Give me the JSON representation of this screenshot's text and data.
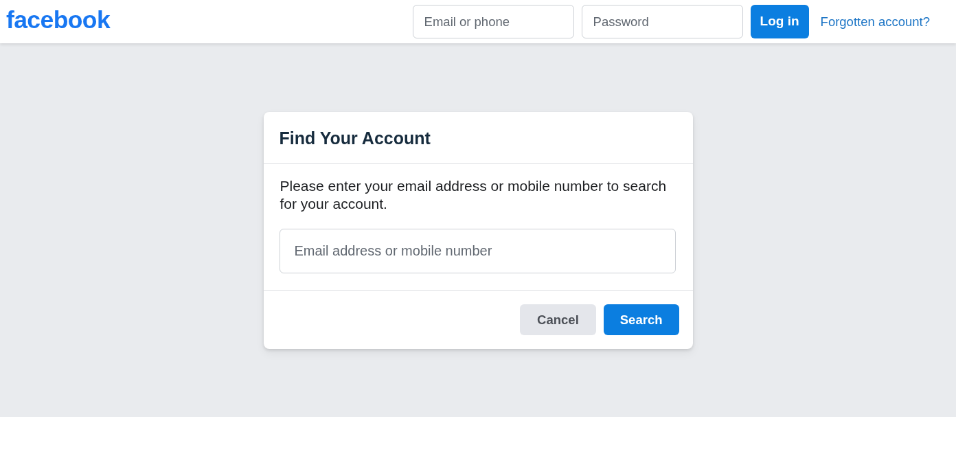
{
  "header": {
    "logo": "facebook",
    "email_field": {
      "placeholder": "Email or phone"
    },
    "password_field": {
      "placeholder": "Password"
    },
    "login_button": "Log in",
    "forgot_link": "Forgotten account?"
  },
  "dialog": {
    "title": "Find Your Account",
    "message": "Please enter your email address or mobile number to search for your account.",
    "search_field": {
      "placeholder": "Email address or mobile number"
    },
    "buttons": [
      {
        "label": "Cancel",
        "kind": "secondary"
      },
      {
        "label": "Search",
        "kind": "primary"
      }
    ]
  }
}
